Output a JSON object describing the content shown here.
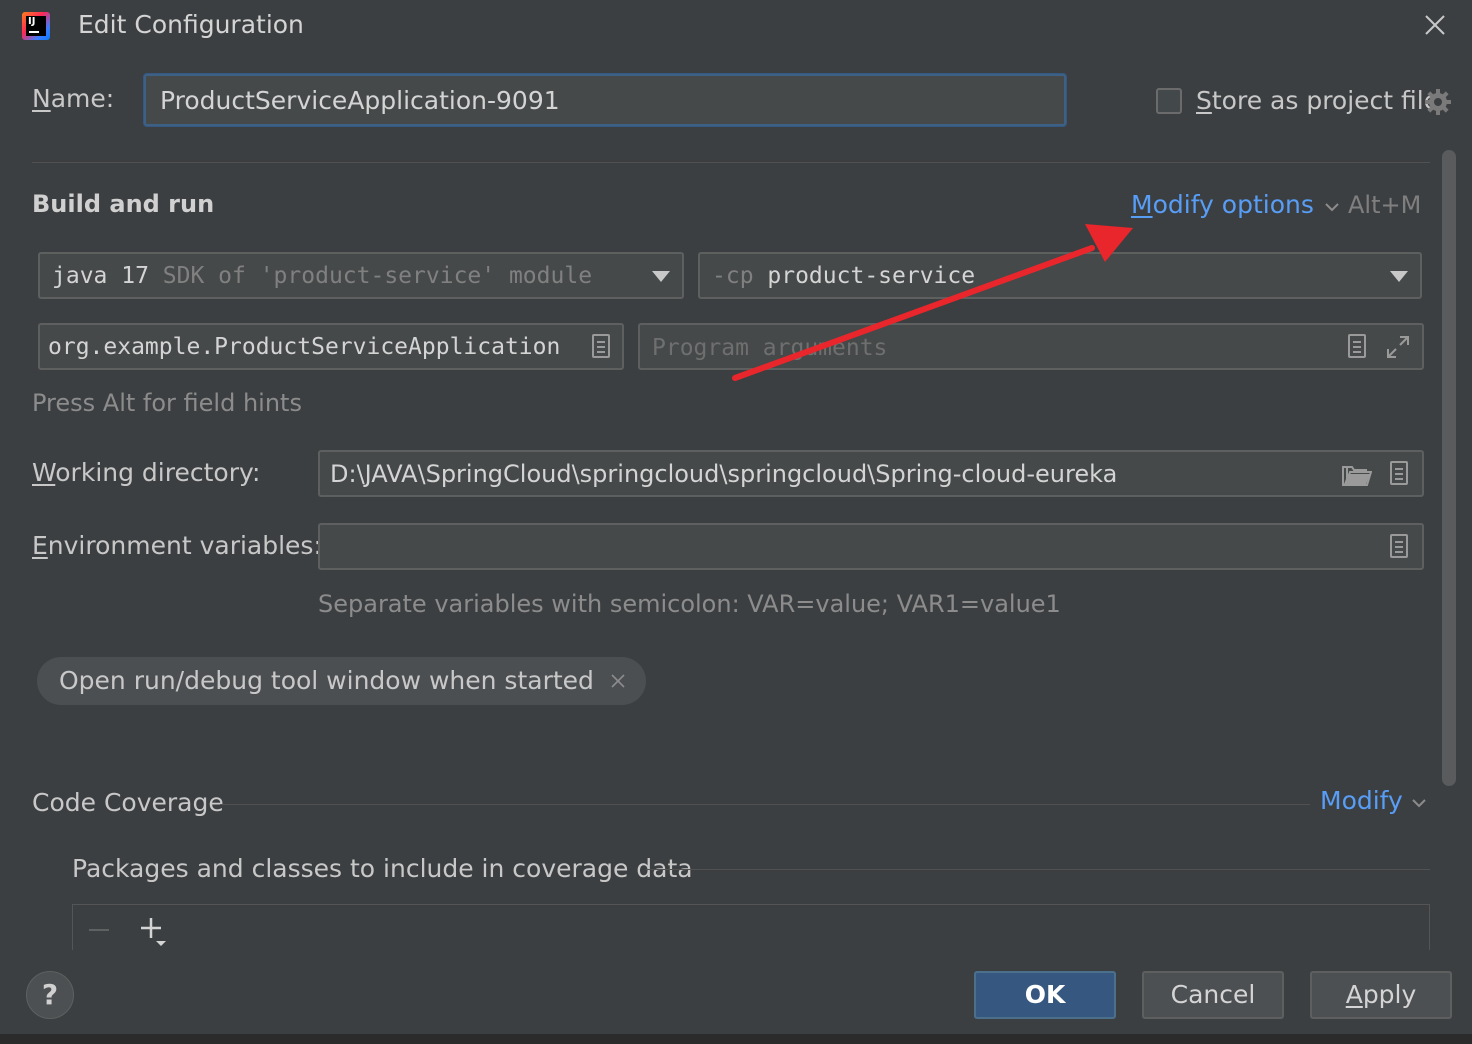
{
  "window": {
    "title": "Edit Configuration"
  },
  "name_row": {
    "label_prefix": "N",
    "label_rest": "ame:",
    "value": "ProductServiceApplication-9091",
    "store_prefix": "S",
    "store_rest": "tore as project file",
    "store_checked": false
  },
  "build_run": {
    "title": "Build and run",
    "modify_prefix": "M",
    "modify_rest": "odify options",
    "shortcut": "Alt+M",
    "sdk_main": "java 17",
    "sdk_hint": " SDK of 'product-service' module",
    "cp_prefix": "-cp",
    "cp_value": " product-service",
    "main_class": "org.example.ProductServiceApplication",
    "program_args_placeholder": "Program arguments",
    "field_hints": "Press Alt for field hints",
    "working_dir_prefix": "W",
    "working_dir_rest": "orking directory:",
    "working_dir_value": "D:\\JAVA\\SpringCloud\\springcloud\\springcloud\\Spring-cloud-eureka",
    "env_prefix": "E",
    "env_rest": "nvironment variables:",
    "env_value": "",
    "env_hint": "Separate variables with semicolon: VAR=value; VAR1=value1",
    "tag_chip": "Open run/debug tool window when started"
  },
  "coverage": {
    "title": "Code Coverage",
    "modify": "Modify",
    "packages_title": "Packages and classes to include in coverage data"
  },
  "footer": {
    "help": "?",
    "ok": "OK",
    "cancel": "Cancel",
    "apply_prefix": "A",
    "apply_rest": "pply"
  },
  "colors": {
    "accent_link": "#589df6",
    "primary_button": "#365880",
    "annotation_arrow": "#e8262b"
  }
}
